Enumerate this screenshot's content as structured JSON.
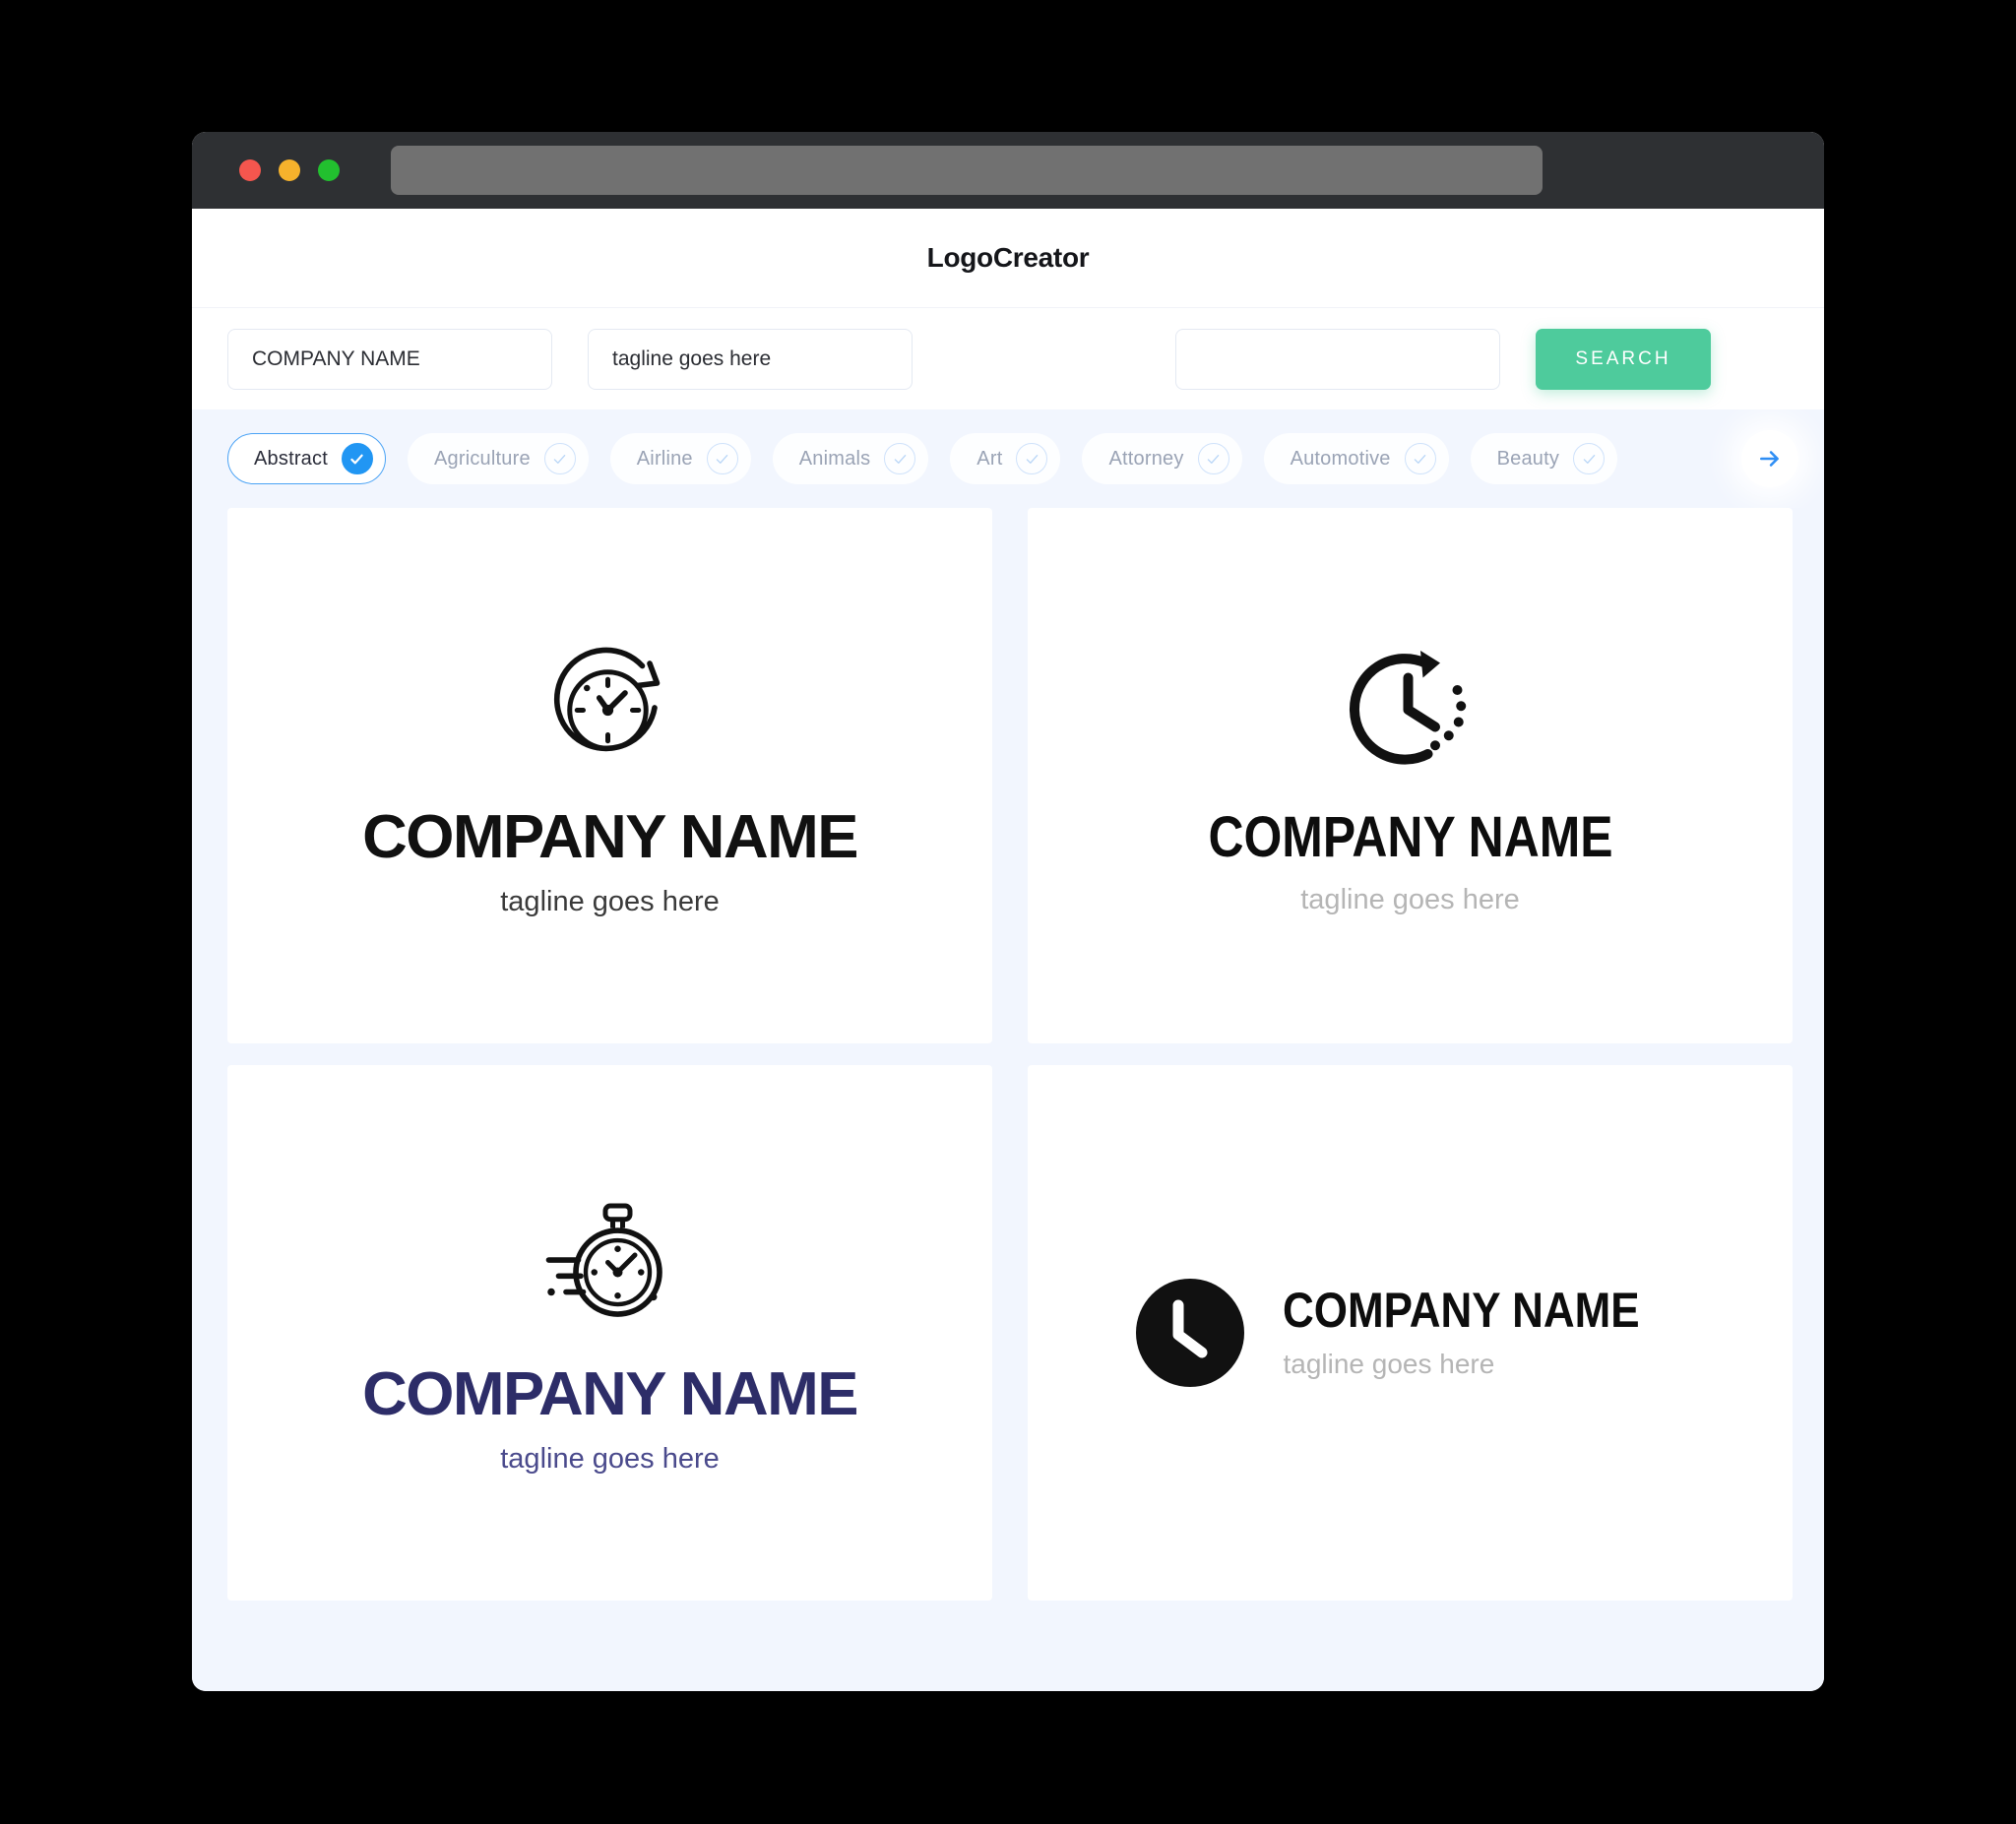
{
  "browser": {
    "traffic_lights": [
      "close",
      "minimize",
      "maximize"
    ],
    "url_value": ""
  },
  "header": {
    "title": "LogoCreator"
  },
  "search": {
    "company_value": "COMPANY NAME",
    "company_placeholder": "COMPANY NAME",
    "tagline_value": "tagline goes here",
    "tagline_placeholder": "tagline goes here",
    "keyword_value": "",
    "keyword_placeholder": "",
    "button_label": "SEARCH",
    "button_color": "#4ECB9C"
  },
  "categories": {
    "next_label": "next",
    "accent_selected": "#2196F3",
    "chips": [
      {
        "label": "Abstract",
        "selected": true
      },
      {
        "label": "Agriculture",
        "selected": false
      },
      {
        "label": "Airline",
        "selected": false
      },
      {
        "label": "Animals",
        "selected": false
      },
      {
        "label": "Art",
        "selected": false
      },
      {
        "label": "Attorney",
        "selected": false
      },
      {
        "label": "Automotive",
        "selected": false
      },
      {
        "label": "Beauty",
        "selected": false
      }
    ]
  },
  "results": {
    "logos": [
      {
        "icon": "clock-refresh-icon",
        "name": "COMPANY NAME",
        "tagline": "tagline goes here",
        "name_color": "#111111",
        "tagline_color": "#3A3A3A",
        "layout": "stacked"
      },
      {
        "icon": "clock-dotted-arrow-icon",
        "name": "COMPANY NAME",
        "tagline": "tagline goes here",
        "name_color": "#0D0D0D",
        "tagline_color": "#B5B5B5",
        "layout": "stacked"
      },
      {
        "icon": "stopwatch-speed-icon",
        "name": "COMPANY NAME",
        "tagline": "tagline goes here",
        "name_color": "#2D2D68",
        "tagline_color": "#4A4A8C",
        "layout": "stacked"
      },
      {
        "icon": "clock-solid-circle-icon",
        "name": "COMPANY NAME",
        "tagline": "tagline goes here",
        "name_color": "#0D0D0D",
        "tagline_color": "#B5B5B5",
        "layout": "horizontal"
      }
    ]
  }
}
